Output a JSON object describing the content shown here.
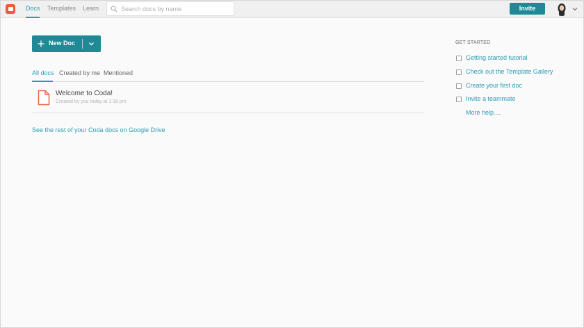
{
  "header": {
    "logo": "coda-logo-icon",
    "tabs": [
      {
        "label": "Docs",
        "active": true
      },
      {
        "label": "Templates",
        "active": false
      },
      {
        "label": "Learn",
        "active": false
      }
    ],
    "search": {
      "placeholder": "Search docs by name",
      "value": "",
      "icon": "search-icon"
    },
    "invite_label": "Invite",
    "avatar": "user-avatar",
    "chevron": "chevron-down-icon"
  },
  "main": {
    "new_doc_label": "New Doc",
    "filters": [
      {
        "label": "All docs",
        "active": true
      },
      {
        "label": "Created by me",
        "active": false
      },
      {
        "label": "Mentioned",
        "active": false
      }
    ],
    "docs": [
      {
        "title": "Welcome to Coda!",
        "meta": "Created by you today at 1:18 pm",
        "icon": "doc-file-icon"
      }
    ],
    "drive_link": "See the rest of your Coda docs on Google Drive"
  },
  "get_started": {
    "heading": "GET STARTED",
    "items": [
      {
        "label": "Getting started tutorial",
        "checked": false
      },
      {
        "label": "Check out the Template Gallery",
        "checked": false
      },
      {
        "label": "Create your first doc",
        "checked": false
      },
      {
        "label": "Invite a teammate",
        "checked": false
      }
    ],
    "more_help": "More help...."
  },
  "colors": {
    "accent": "#2a9cb5",
    "button": "#1f8a95",
    "brand": "#f05a3c"
  }
}
